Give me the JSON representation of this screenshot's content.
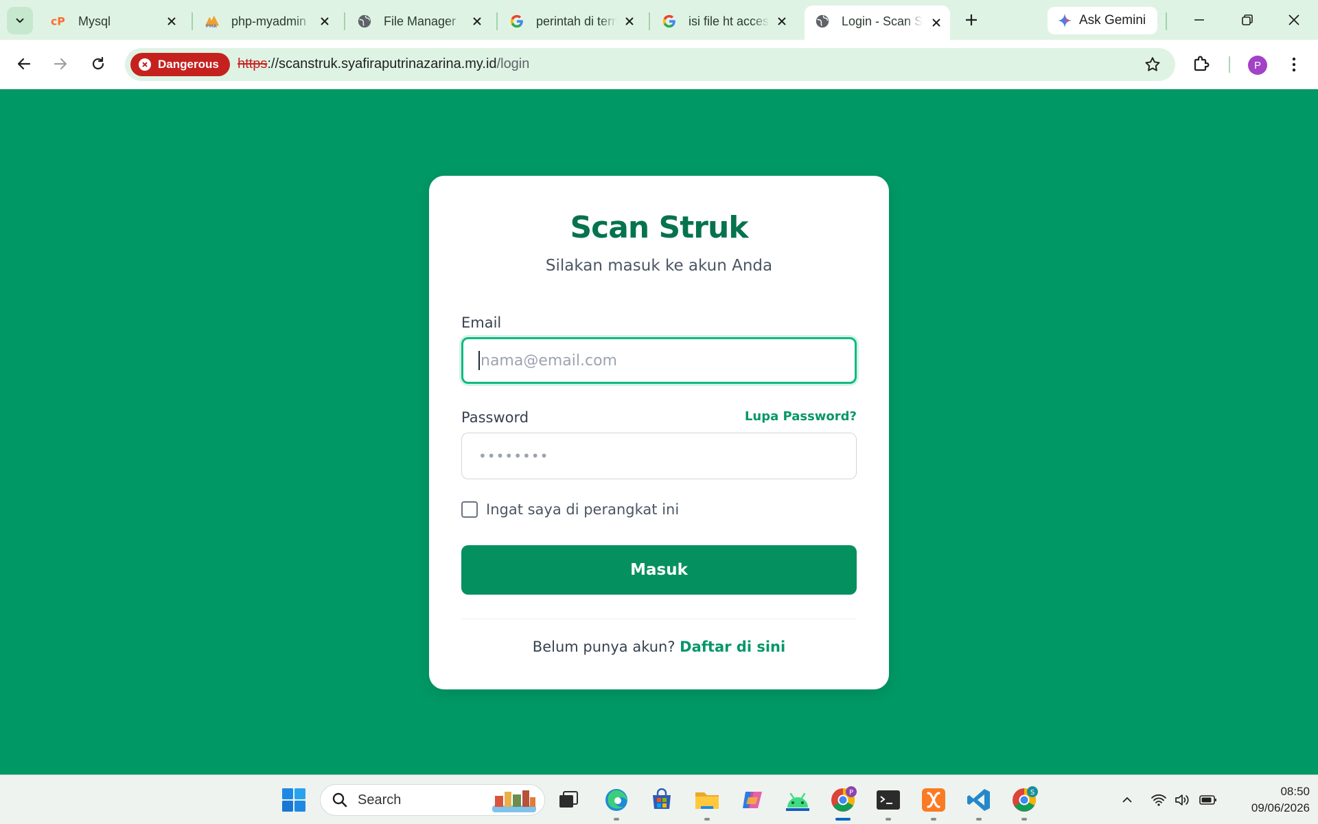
{
  "browser": {
    "tabs": [
      {
        "title": "Mysql",
        "favicon": "cpanel-icon"
      },
      {
        "title": "php-myadmin",
        "favicon": "phpmyadmin-icon"
      },
      {
        "title": "File Manager",
        "favicon": "globe-icon"
      },
      {
        "title": "perintah di terminal",
        "favicon": "google-icon"
      },
      {
        "title": "isi file ht access",
        "favicon": "google-icon"
      },
      {
        "title": "Login - Scan Struk",
        "favicon": "globe-icon",
        "active": true
      }
    ],
    "ask_gemini_label": "Ask Gemini",
    "security_chip_label": "Dangerous",
    "url": {
      "scheme": "https",
      "host": "://scanstruk.syafiraputrinazarina.my.id",
      "path": "/login"
    },
    "profile_initial": "P"
  },
  "login": {
    "brand": "Scan Struk",
    "subtitle": "Silakan masuk ke akun Anda",
    "email_label": "Email",
    "email_placeholder": "nama@email.com",
    "password_label": "Password",
    "password_value": "••••••••",
    "forgot_link": "Lupa Password?",
    "remember_label": "Ingat saya di perangkat ini",
    "remember_checked": false,
    "submit_label": "Masuk",
    "register_prompt": "Belum punya akun?",
    "register_link": "Daftar di sini"
  },
  "taskbar": {
    "search_label": "Search",
    "time": "08:50",
    "date": "09/06/2026",
    "chrome_profile_badge": "P",
    "chrome_second_badge": "S"
  },
  "colors": {
    "page_background": "#009966",
    "brand_green": "#05734e",
    "button_green": "#05905f",
    "focus_ring": "#10b981",
    "danger_red": "#c5221f"
  }
}
